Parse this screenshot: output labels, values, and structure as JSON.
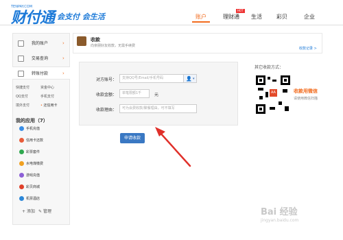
{
  "brand": {
    "logo": "财付通",
    "logo_sub": "TENPAY.COM",
    "slogan": "会支付 会生活"
  },
  "nav": {
    "items": [
      "账户",
      "理财通",
      "生活",
      "彩贝",
      "企业"
    ],
    "active": "账户",
    "hot_badge": "HOT"
  },
  "sidebar": {
    "items": [
      {
        "label": "我的账户",
        "icon": "home-icon"
      },
      {
        "label": "交易查询",
        "icon": "search-list-icon"
      },
      {
        "label": "转账付款",
        "icon": "transfer-icon"
      }
    ],
    "subs": [
      "快捷支付",
      "资金中心",
      "QQ支付",
      "手机支付",
      "境外支付",
      "还信用卡"
    ],
    "apps_title": "我的应用（7）",
    "apps": [
      {
        "label": "手机充值",
        "color": "#3a8ee6"
      },
      {
        "label": "信用卡还款",
        "color": "#e85c3a"
      },
      {
        "label": "彩票套件",
        "color": "#2fa84f"
      },
      {
        "label": "水电煤缴费",
        "color": "#f0a020"
      },
      {
        "label": "游戏充值",
        "color": "#8c5fd6"
      },
      {
        "label": "彩贝商城",
        "color": "#e0402a"
      },
      {
        "label": "机票酒店",
        "color": "#2c87d8"
      }
    ],
    "bottom_add": "添加",
    "bottom_manage": "管理"
  },
  "main": {
    "title": "收款",
    "subtitle": "向亲朋好友收款，无需手续费",
    "records_link": "收款记录 >"
  },
  "form": {
    "payer_label": "对方账号：",
    "payer_placeholder": "支持QQ号/Email/手机号码",
    "amount_label": "收款金额：",
    "amount_placeholder": "单笔限额1千",
    "amount_unit": "元",
    "reason_label": "收款理由：",
    "reason_placeholder": "可为会费收款/聚餐理由，可不填写",
    "submit_label": "申请收款"
  },
  "right": {
    "other_methods": "其它收款方式：",
    "qr_title": "收款用微信",
    "qr_note": "请使用微信扫描"
  },
  "watermark": {
    "main": "Bai 经验",
    "sub": "jingyan.baidu.com"
  },
  "colors": {
    "accent": "#f26b1d",
    "brand_blue": "#1d7ad8",
    "button_blue": "#3a78c3",
    "arrow_red": "#e0302a"
  }
}
